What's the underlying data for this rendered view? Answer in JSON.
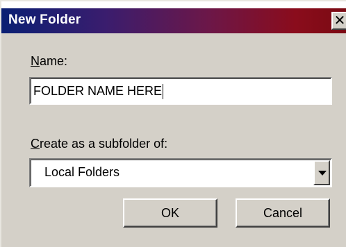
{
  "dialog": {
    "title": "New Folder",
    "close_glyph": "✕"
  },
  "name": {
    "label_accel": "N",
    "label_rest": "ame:",
    "value": "FOLDER NAME HERE"
  },
  "subfolder": {
    "label_accel": "C",
    "label_rest": "reate as a subfolder of:",
    "selected": "Local Folders"
  },
  "buttons": {
    "ok": "OK",
    "cancel": "Cancel"
  },
  "icons": {
    "close": "close-icon",
    "dropdown": "chevron-down-icon"
  },
  "colors": {
    "titlebar_start": "#0a1f73",
    "titlebar_end": "#7a0a12",
    "dialog_face": "#d4d0c8"
  }
}
